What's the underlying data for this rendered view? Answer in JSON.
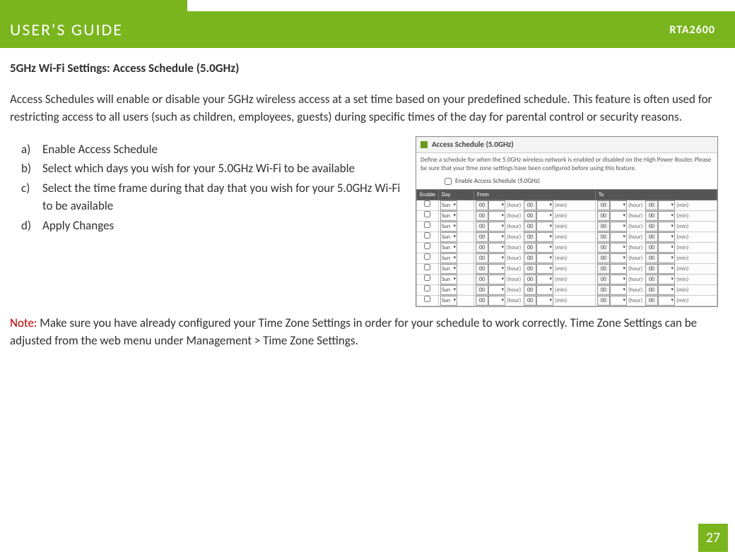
{
  "header": {
    "title": "USER'S GUIDE",
    "model": "RTA2600"
  },
  "section_title": "5GHz Wi-Fi Settings: Access Schedule (5.0GHz)",
  "intro": "Access Schedules will enable or disable your 5GHz wireless access at a set time based on your predefined schedule. This feature is often used for restricting access to all users (such as children, employees, guests) during specific times of the day for parental control or security reasons.",
  "steps": [
    {
      "letter": "a)",
      "text": "Enable Access Schedule"
    },
    {
      "letter": "b)",
      "text": "Select which days you wish for your 5.0GHz Wi-Fi to be available"
    },
    {
      "letter": "c)",
      "text": "Select the time frame during that day that you wish for your 5.0GHz Wi-Fi to be available"
    },
    {
      "letter": "d)",
      "text": "Apply Changes"
    }
  ],
  "screenshot": {
    "title": "Access Schedule (5.0GHz)",
    "desc": "Define a schedule for when the 5.0GHz wireless network is enabled or disabled on the High Power Router. Please be sure that your time zone settings have been configured before using this feature.",
    "enable_label": "Enable Access Schedule (5.0GHz)",
    "columns": {
      "enable": "Enable",
      "day": "Day",
      "from": "From",
      "to": "To"
    },
    "day_value": "Sun",
    "hour": "00",
    "min": "00",
    "hour_lbl": "(hour)",
    "min_lbl": "(min)",
    "rows": 10
  },
  "note": {
    "label": "Note:",
    "text": "  Make sure you have already configured your Time Zone Settings in order for your schedule to work correctly. Time Zone Settings can be adjusted from the web menu under Management > Time Zone Settings."
  },
  "page_number": "27"
}
